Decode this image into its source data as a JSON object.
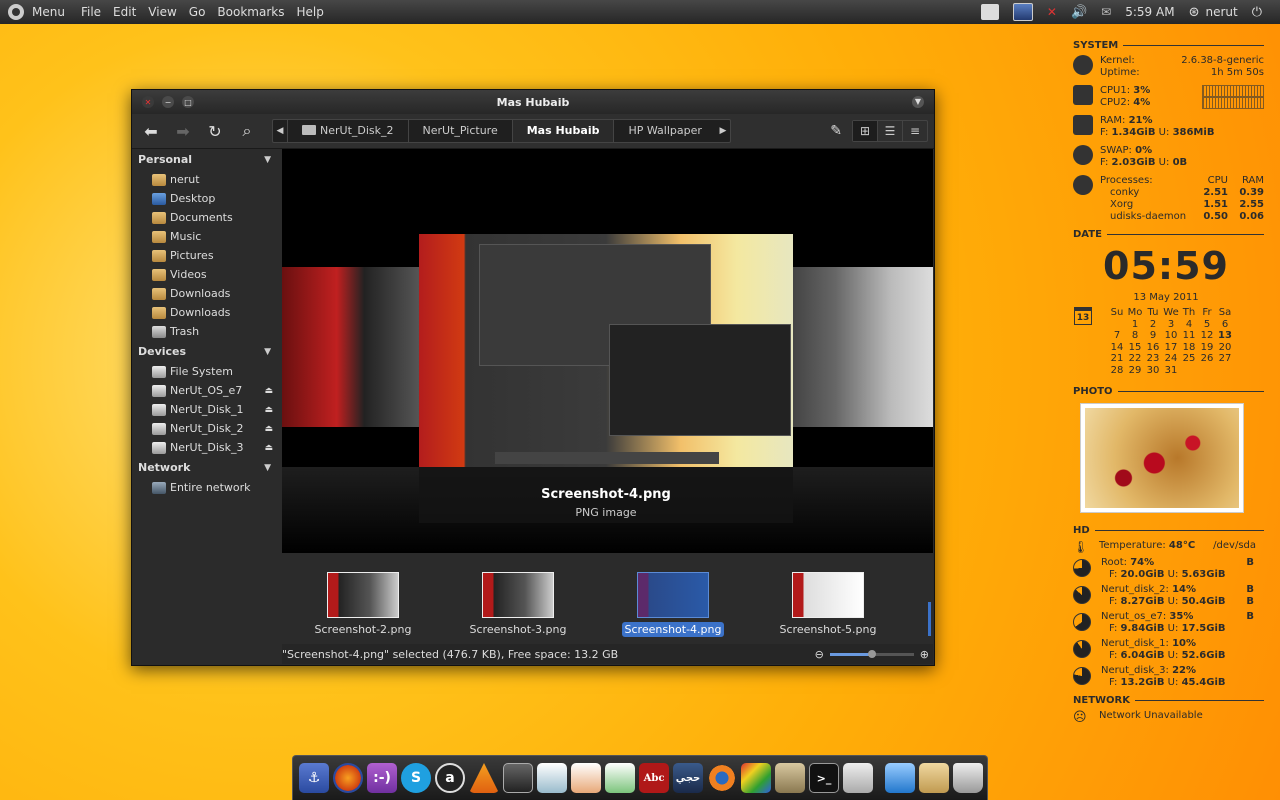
{
  "top_panel": {
    "menu": [
      "Menu",
      "File",
      "Edit",
      "View",
      "Go",
      "Bookmarks",
      "Help"
    ],
    "clock": "5:59 AM",
    "user": "nerut"
  },
  "window": {
    "title": "Mas Hubaib",
    "path": [
      "NerUt_Disk_2",
      "NerUt_Picture",
      "Mas Hubaib",
      "HP Wallpaper"
    ],
    "sidebar": {
      "personal": {
        "label": "Personal",
        "items": [
          "nerut",
          "Desktop",
          "Documents",
          "Music",
          "Pictures",
          "Videos",
          "Downloads",
          "Downloads",
          "Trash"
        ]
      },
      "devices": {
        "label": "Devices",
        "items": [
          "File System",
          "NerUt_OS_e7",
          "NerUt_Disk_1",
          "NerUt_Disk_2",
          "NerUt_Disk_3"
        ]
      },
      "network": {
        "label": "Network",
        "items": [
          "Entire network"
        ]
      }
    },
    "preview": {
      "filename": "Screenshot-4.png",
      "type": "PNG image"
    },
    "thumbnails": [
      "Screenshot-2.png",
      "Screenshot-3.png",
      "Screenshot-4.png",
      "Screenshot-5.png"
    ],
    "selected_thumbnail": 2,
    "status_text": "\"Screenshot-4.png\" selected (476.7 KB), Free space: 13.2 GB",
    "zoom_level": 0.5
  },
  "conky": {
    "system": {
      "header": "SYSTEM",
      "kernel_label": "Kernel:",
      "kernel": "2.6.38-8-generic",
      "uptime_label": "Uptime:",
      "uptime": "1h 5m 50s",
      "cpu1_label": "CPU1:",
      "cpu1": "3%",
      "cpu2_label": "CPU2:",
      "cpu2": "4%",
      "ram_label": "RAM:",
      "ram": "21%",
      "ram_f_label": "F:",
      "ram_free": "1.34GiB",
      "ram_u_label": "U:",
      "ram_used": "386MiB",
      "swap_label": "SWAP:",
      "swap": "0%",
      "swap_f_label": "F:",
      "swap_free": "2.03GiB",
      "swap_u_label": "U:",
      "swap_used": "0B",
      "processes_label": "Processes:",
      "cpu_col": "CPU",
      "ram_col": "RAM",
      "processes": [
        {
          "name": "conky",
          "cpu": "2.51",
          "ram": "0.39"
        },
        {
          "name": "Xorg",
          "cpu": "1.51",
          "ram": "2.55"
        },
        {
          "name": "udisks-daemon",
          "cpu": "0.50",
          "ram": "0.06"
        }
      ]
    },
    "date": {
      "header": "DATE",
      "clock": "05:59",
      "date": "13 May 2011",
      "cal_icon_day": "13",
      "weekdays": [
        "Su",
        "Mo",
        "Tu",
        "We",
        "Th",
        "Fr",
        "Sa"
      ],
      "days": [
        "",
        "1",
        "2",
        "3",
        "4",
        "5",
        "6",
        "7",
        "8",
        "9",
        "10",
        "11",
        "12",
        "13",
        "14",
        "15",
        "16",
        "17",
        "18",
        "19",
        "20",
        "21",
        "22",
        "23",
        "24",
        "25",
        "26",
        "27",
        "28",
        "29",
        "30",
        "31"
      ]
    },
    "photo": {
      "header": "PHOTO"
    },
    "hd": {
      "header": "HD",
      "temp_label": "Temperature:",
      "temp": "48°C",
      "device": "/dev/sda",
      "disks": [
        {
          "name": "Root:",
          "pct": "74%",
          "free": "20.0GiB",
          "used": "5.63GiB",
          "fill": 0.74,
          "b1": "B",
          "b2": ""
        },
        {
          "name": "Nerut_disk_2:",
          "pct": "14%",
          "free": "8.27GiB",
          "used": "50.4GiB",
          "fill": 0.86,
          "b1": "B",
          "b2": "B"
        },
        {
          "name": "Nerut_os_e7:",
          "pct": "35%",
          "free": "9.84GiB",
          "used": "17.5GiB",
          "fill": 0.65,
          "b1": "B",
          "b2": ""
        },
        {
          "name": "Nerut_disk_1:",
          "pct": "10%",
          "free": "6.04GiB",
          "used": "52.6GiB",
          "fill": 0.9,
          "b1": "",
          "b2": ""
        },
        {
          "name": "Nerut_disk_3:",
          "pct": "22%",
          "free": "13.2GiB",
          "used": "45.4GiB",
          "fill": 0.78,
          "b1": "",
          "b2": ""
        }
      ],
      "f_label": "F:",
      "u_label": "U:"
    },
    "network": {
      "header": "NETWORK",
      "status": "Network Unavailable"
    }
  },
  "dock": {
    "icons": [
      "anchor-icon",
      "firefox-icon",
      "pidgin-icon",
      "skype-icon",
      "amazon-icon",
      "vlc-icon",
      "monitor-icon",
      "writer-icon",
      "impress-icon",
      "calc-icon",
      "dictionary-icon",
      "arabic-app-icon",
      "blender-icon",
      "paint-icon",
      "gimp-icon",
      "terminal-icon",
      "file-cabinet-icon",
      "desktop-icon",
      "home-folder-icon",
      "trash-icon"
    ],
    "abc_label": "Abc"
  },
  "colors": {
    "accent": "#3b72c9",
    "window_bg": "#2b2b2b",
    "desktop_orange": "#ffb010"
  }
}
